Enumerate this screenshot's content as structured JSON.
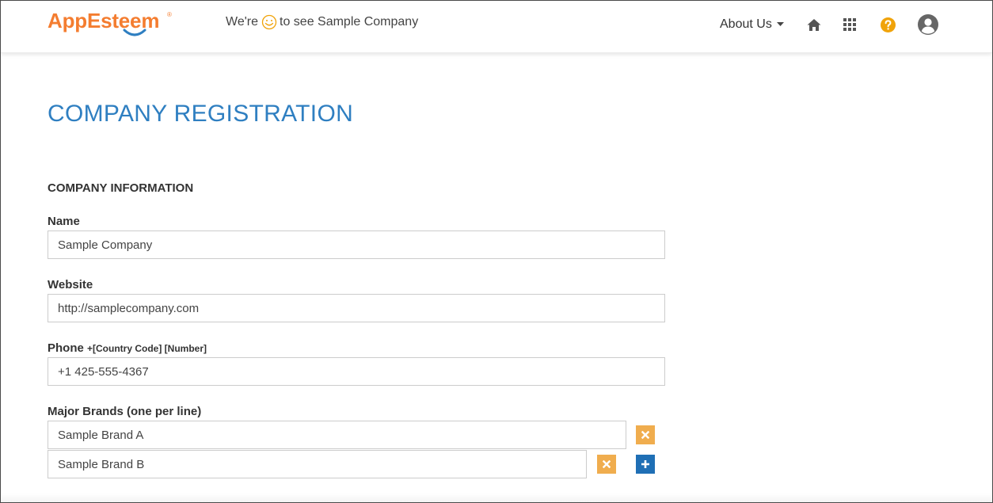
{
  "header": {
    "logo_text": "AppEsteem",
    "logo_reg": "®",
    "tagline_before": "We're",
    "tagline_after": "to see Sample Company",
    "about_label": "About Us",
    "icons": [
      "home-icon",
      "apps-grid-icon",
      "help-icon",
      "user-account-icon"
    ]
  },
  "page": {
    "title": "COMPANY REGISTRATION",
    "section_title": "COMPANY INFORMATION"
  },
  "form": {
    "name_label": "Name",
    "name_value": "Sample Company",
    "website_label": "Website",
    "website_value": "http://samplecompany.com",
    "phone_label": "Phone",
    "phone_hint": "+[Country Code] [Number]",
    "phone_value": "+1 425-555-4367",
    "brands_label": "Major Brands (one per line)",
    "brands": [
      "Sample Brand A",
      "Sample Brand B"
    ]
  },
  "colors": {
    "brand_orange": "#f47d30",
    "title_blue": "#2f7fc1",
    "remove_button": "#f0ad4e",
    "add_button": "#1f6fb5",
    "help_icon": "#f0a30a"
  }
}
